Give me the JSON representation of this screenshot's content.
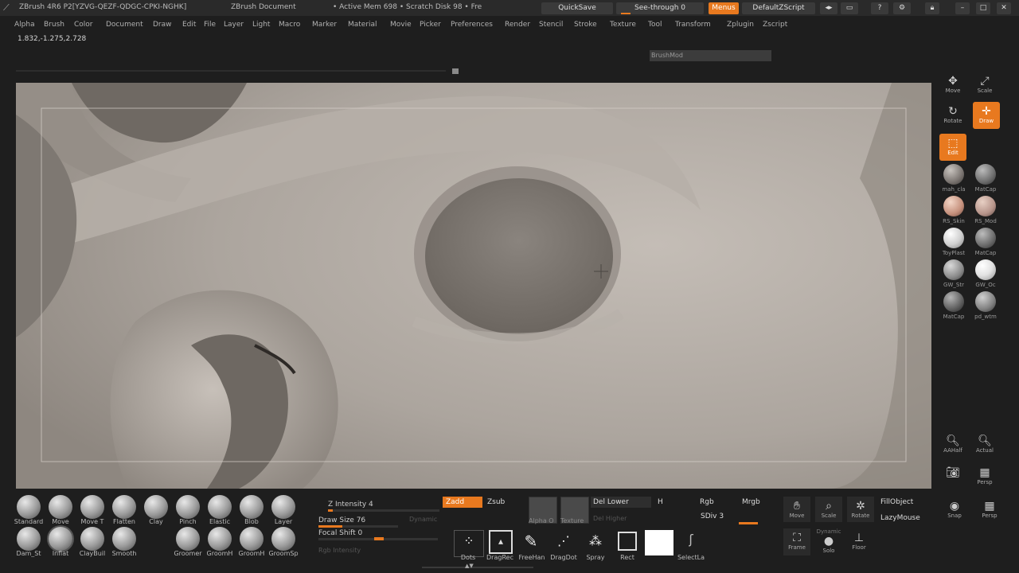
{
  "titlebar": {
    "app": "ZBrush 4R6 P2[YZVG-QEZF-QDGC-CPKI-NGHK]",
    "doc": "ZBrush Document",
    "mem": "• Active Mem 698 • Scratch Disk 98 • Fre",
    "quicksave": "QuickSave",
    "seethrough": "See-through  0",
    "menus": "Menus",
    "script": "DefaultZScript"
  },
  "menubar": [
    "Alpha",
    "Brush",
    "Color",
    "Document",
    "Draw",
    "Edit",
    "File",
    "Layer",
    "Light",
    "Macro",
    "Marker",
    "Material",
    "Movie",
    "Picker",
    "Preferences",
    "Render",
    "Stencil",
    "Stroke",
    "Texture",
    "Tool",
    "Transform",
    "Zplugin",
    "Zscript"
  ],
  "coords": "1.832,-1.275,2.728",
  "brushmod": "BrushMod",
  "right_shelf": {
    "move": "Move",
    "scale": "Scale",
    "rotate": "Rotate",
    "draw": "Draw",
    "edit": "Edit",
    "materials": [
      "mah_cla",
      "MatCap",
      "RS_Skin",
      "RS_Mod",
      "ToyPlast",
      "MatCap",
      "GW_Str",
      "GW_Oc",
      "MatCap",
      "pd_wtm"
    ],
    "aahalf": "AAHalf",
    "actual": "Actual",
    "persp": "Persp"
  },
  "brushes_row1": [
    "Standard",
    "Move",
    "Move T",
    "Flatten",
    "Clay",
    "Pinch",
    "Elastic",
    "Blob",
    "Layer"
  ],
  "brushes_row2": [
    "Dam_St",
    "Inflat",
    "ClayBuil",
    "Smooth",
    "",
    "Groomer",
    "GroomH",
    "GroomH",
    "GroomSp"
  ],
  "sliders": {
    "z_intensity": "Z Intensity 4",
    "z_intensity_val": 4,
    "dynamic": "Dynamic",
    "draw_size": "Draw Size 76",
    "draw_size_val": 76,
    "focal_shift": "Focal Shift 0",
    "rgb_intensity": "Rgb Intensity"
  },
  "zmodes": {
    "zadd": "Zadd",
    "zsub": "Zsub"
  },
  "alpha_tex": {
    "alpha": "Alpha O",
    "texture": "Texture"
  },
  "del": {
    "lower": "Del Lower",
    "higher": "Del Higher",
    "h": "H"
  },
  "color": {
    "rgb": "Rgb",
    "mrgb": "Mrgb",
    "sdiv": "SDiv 3"
  },
  "strokes": [
    "Dots",
    "DragRec",
    "FreeHan",
    "DragDot",
    "Spray",
    "Rect",
    "",
    "SelectLa"
  ],
  "bottom_tools": {
    "move": "Move",
    "scale": "Scale",
    "rotate": "Rotate",
    "fillobject": "FillObject",
    "lazymouse": "LazyMouse",
    "snap": "Snap",
    "perspb": "Persp",
    "frame": "Frame",
    "solo": "Solo",
    "floor": "Floor",
    "dynamic": "Dynamic"
  },
  "colors": {
    "accent": "#e8791f",
    "clay": "#a59d96",
    "ui_bg": "#1e1e1e"
  }
}
